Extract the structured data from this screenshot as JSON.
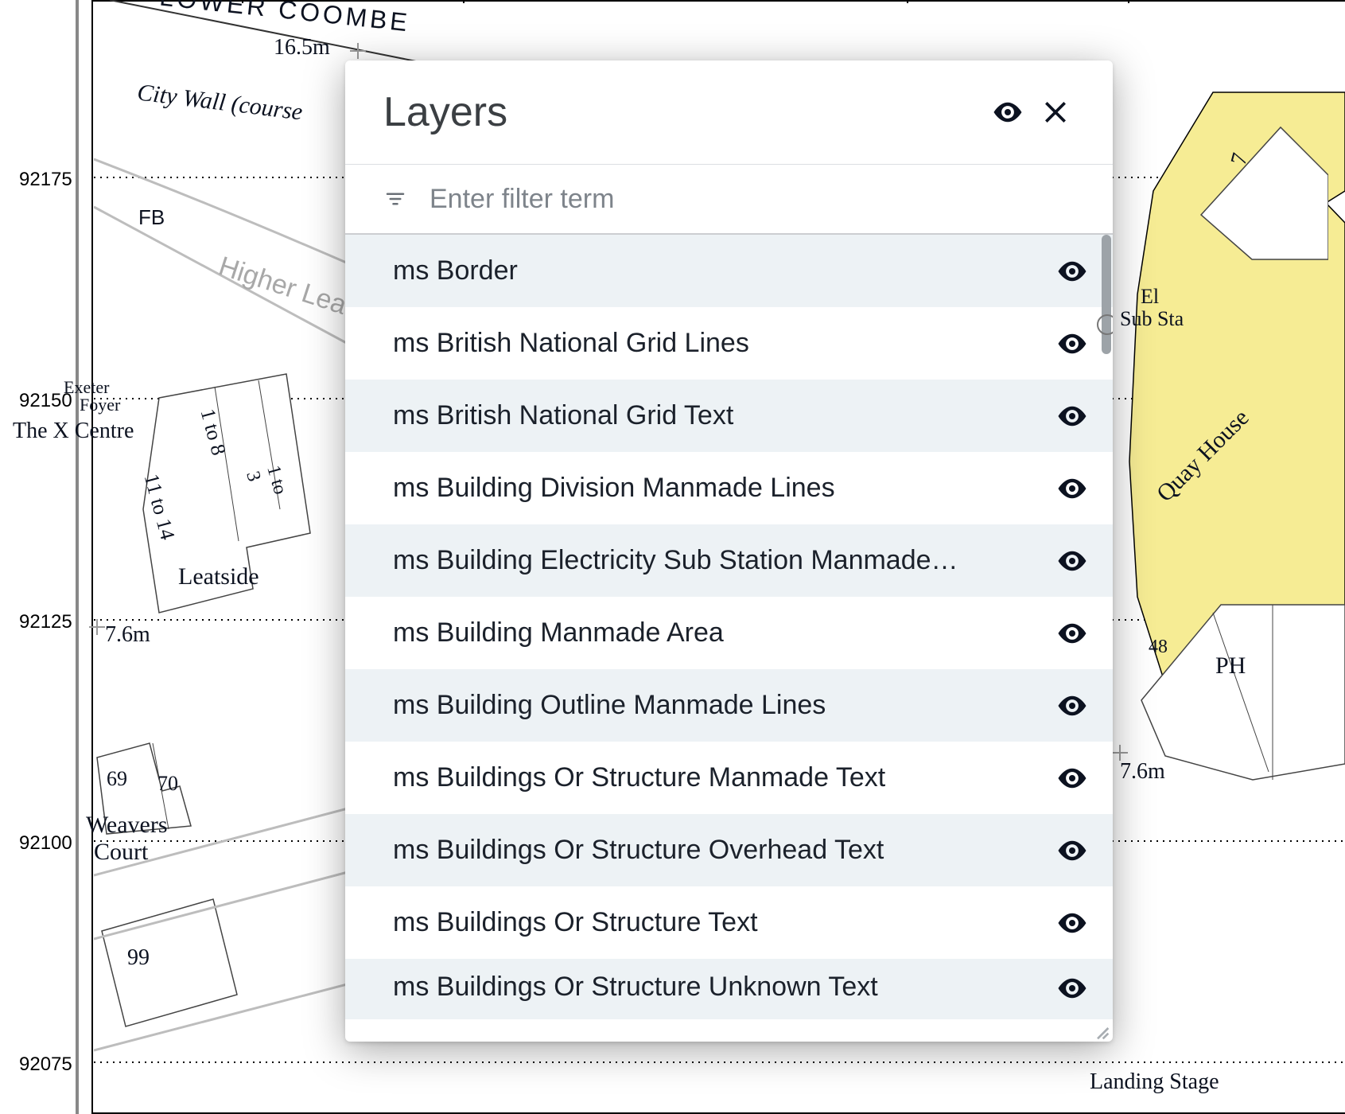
{
  "panel": {
    "title": "Layers",
    "filter_placeholder": "Enter filter term",
    "layers": [
      {
        "name": "ms Border"
      },
      {
        "name": "ms British National Grid Lines"
      },
      {
        "name": "ms British National Grid Text"
      },
      {
        "name": "ms Building Division Manmade Lines"
      },
      {
        "name": "ms Building Electricity Sub Station Manmade…"
      },
      {
        "name": "ms Building Manmade Area"
      },
      {
        "name": "ms Building Outline Manmade Lines"
      },
      {
        "name": "ms Buildings Or Structure Manmade Text"
      },
      {
        "name": "ms Buildings Or Structure Overhead Text"
      },
      {
        "name": "ms Buildings Or Structure Text"
      },
      {
        "name": "ms Buildings Or Structure Unknown Text"
      }
    ]
  },
  "axis_labels": [
    "92175",
    "92150",
    "92125",
    "92100",
    "92075"
  ],
  "map_labels": {
    "lower_coombe": "LOWER  COOMBE",
    "elev1": "16.5m",
    "city_wall": "City Wall (course",
    "fb": "FB",
    "higher_lea": "Higher Lea",
    "exeter": "Exeter",
    "foyer": "Foyer",
    "xcentre": "The X Centre",
    "n1to8": "1 to 8",
    "n11to14": "11 to 14",
    "n1to3": "1 to\n3",
    "leatside": "Leatside",
    "elev2": "7.6m",
    "n69": "69",
    "n70": "70",
    "weavers": "Weavers",
    "court": "Court",
    "n99": "99",
    "landing": "Landing Stage",
    "elsubsta1": "El",
    "elsubsta2": "Sub Sta",
    "quayhouse": "Quay House",
    "n48": "48",
    "ph": "PH",
    "n7": "7",
    "elev3": "7.6m"
  }
}
